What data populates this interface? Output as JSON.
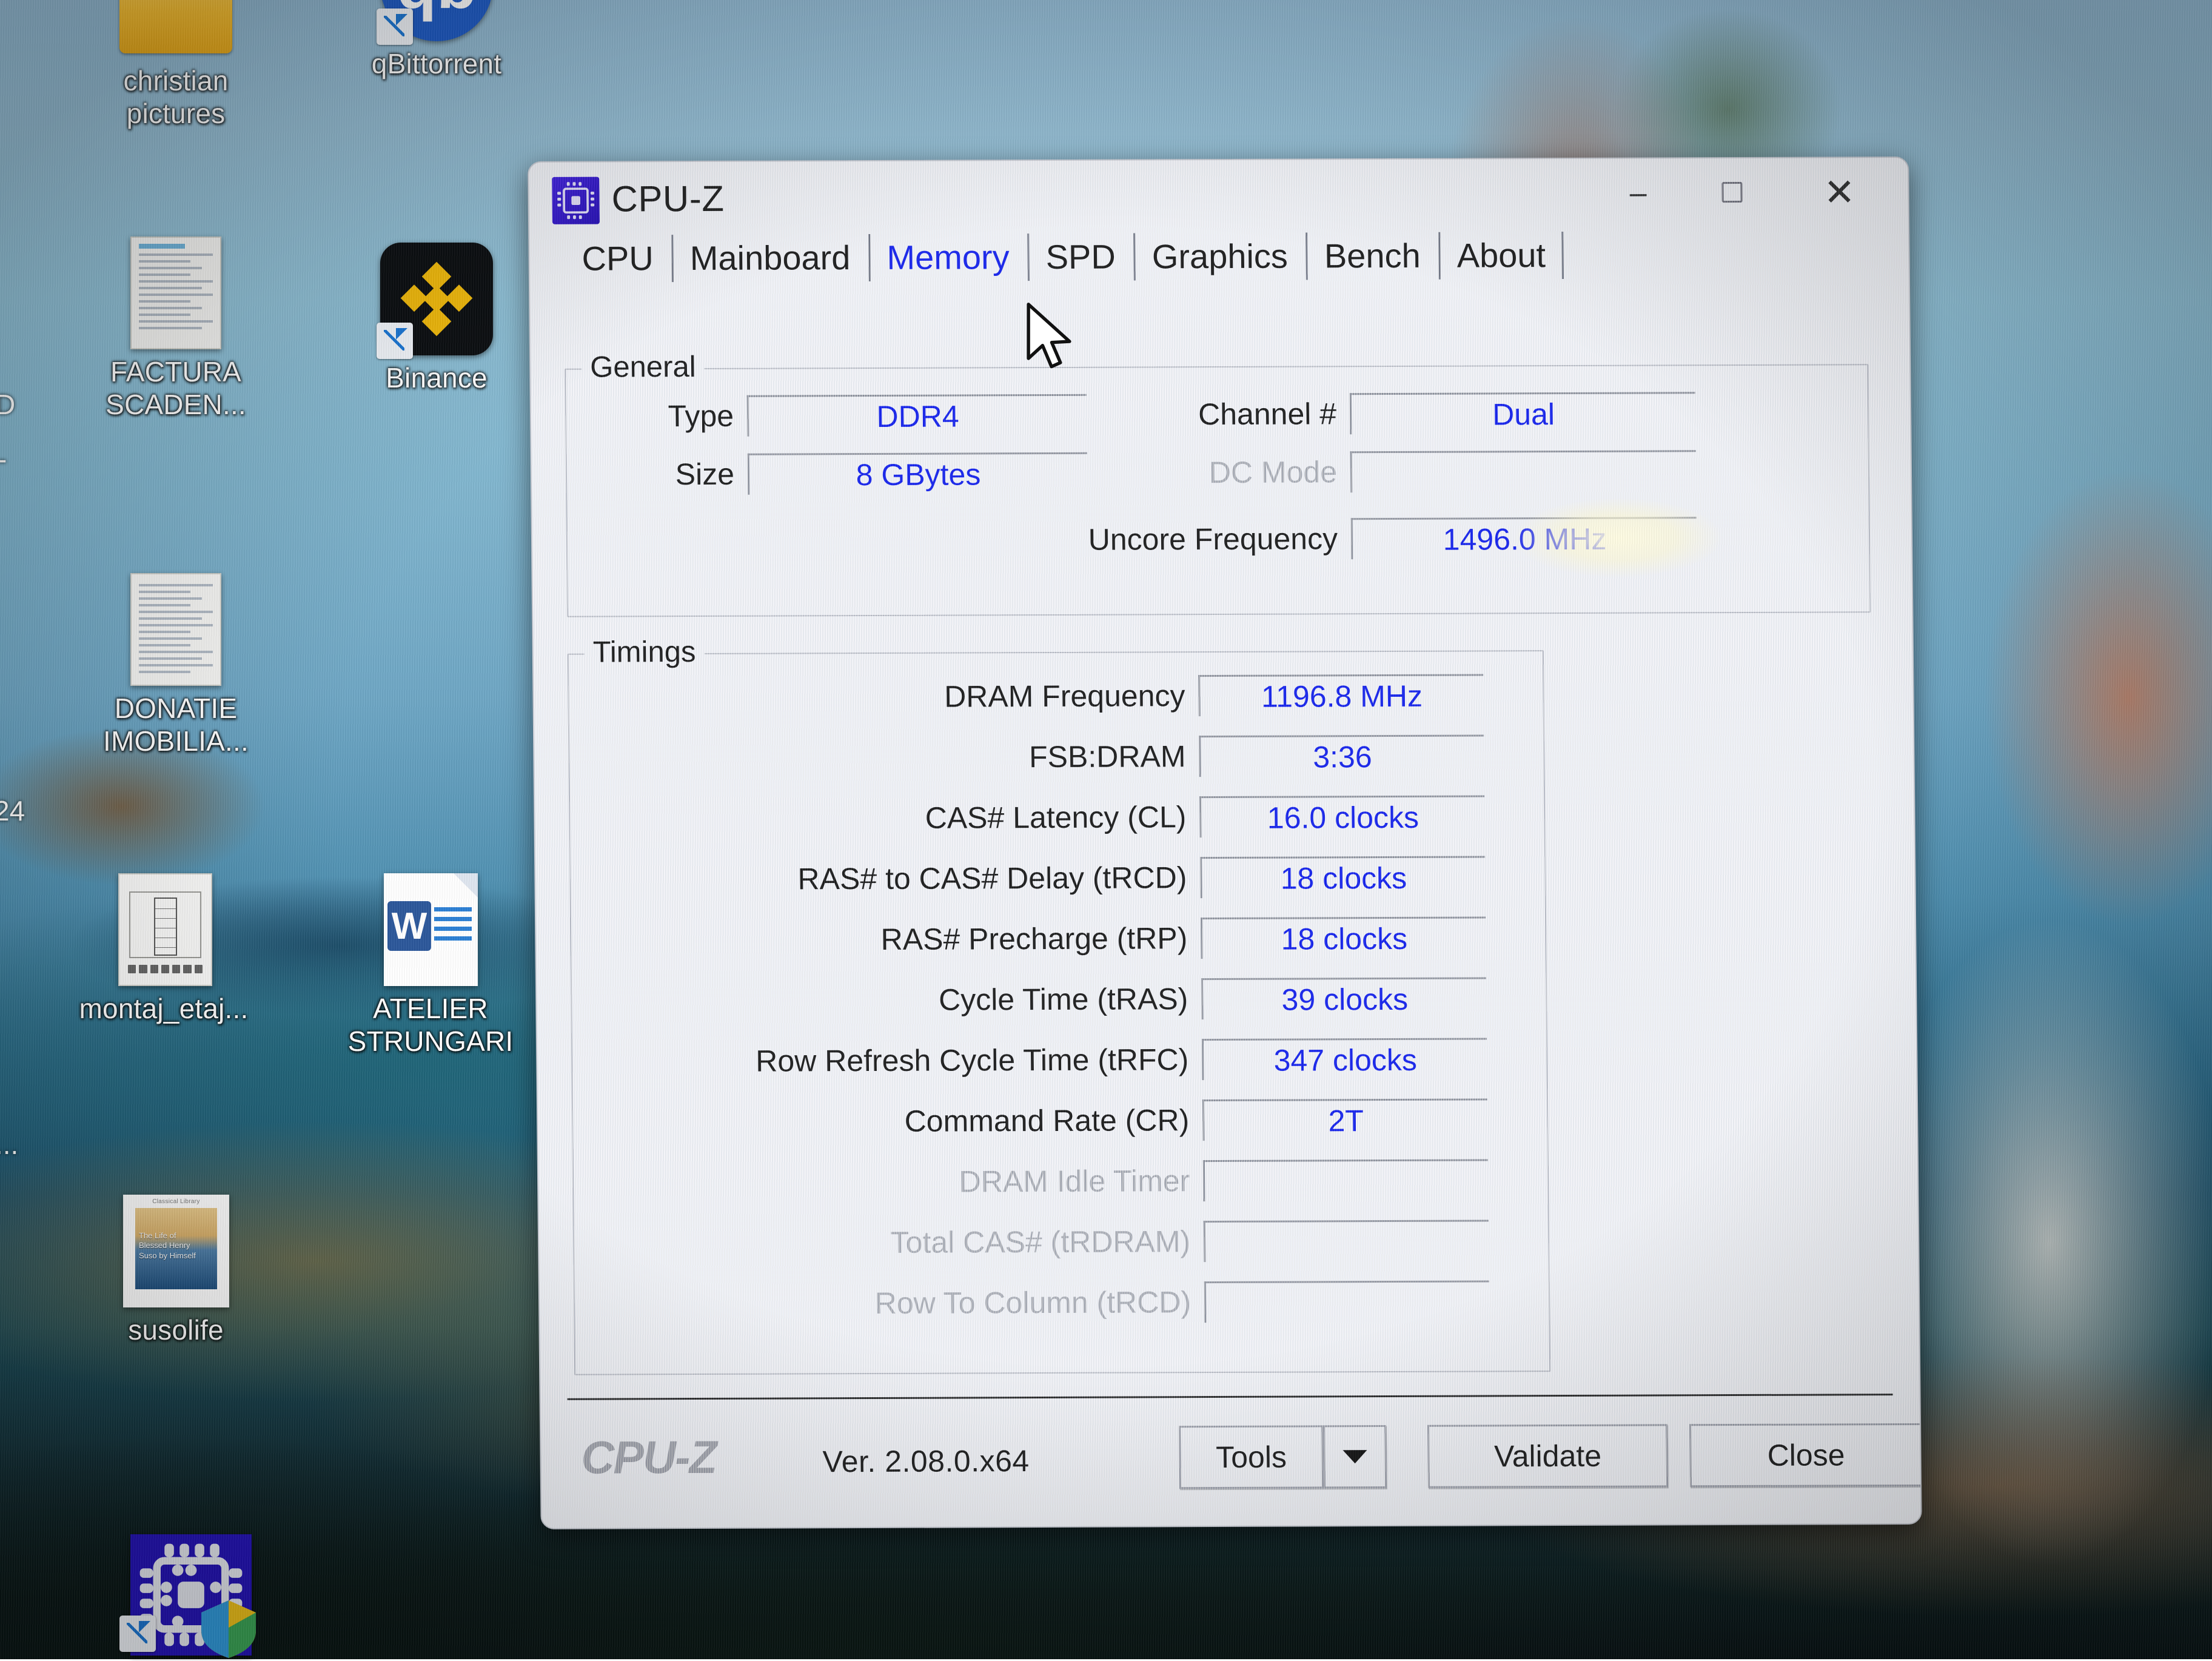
{
  "desktop": {
    "icons": [
      {
        "label": "christian pictures",
        "icon": "folder-icon"
      },
      {
        "label": "qBittorrent",
        "icon": "qbittorrent-icon"
      },
      {
        "label": "FACTURA SCADEN...",
        "icon": "document-icon"
      },
      {
        "label": "Binance",
        "icon": "binance-icon"
      },
      {
        "label": "DONATIE IMOBILIA...",
        "icon": "document-icon"
      },
      {
        "label": "montaj_etaj...",
        "icon": "drawing-document-icon"
      },
      {
        "label": "ATELIER STRUNGARI",
        "icon": "word-document-icon"
      },
      {
        "label": "susolife",
        "icon": "book-cover-icon"
      },
      {
        "label": "",
        "icon": "cpuz-shortcut-icon"
      }
    ],
    "edge_fragments": {
      "left_top_1": "D",
      "left_top_2": "-",
      "left_mid": "24",
      "left_low": "..."
    }
  },
  "window": {
    "title": "CPU-Z",
    "icon": "cpuz-icon",
    "controls": {
      "minimize": "–",
      "maximize": "maximize-icon",
      "close": "✕"
    }
  },
  "tabs": [
    {
      "label": "CPU",
      "selected": false
    },
    {
      "label": "Mainboard",
      "selected": false
    },
    {
      "label": "Memory",
      "selected": true
    },
    {
      "label": "SPD",
      "selected": false
    },
    {
      "label": "Graphics",
      "selected": false
    },
    {
      "label": "Bench",
      "selected": false
    },
    {
      "label": "About",
      "selected": false
    }
  ],
  "general": {
    "title": "General",
    "left": [
      {
        "label": "Type",
        "value": "DDR4",
        "disabled": false
      },
      {
        "label": "Size",
        "value": "8 GBytes",
        "disabled": false
      }
    ],
    "right": [
      {
        "label": "Channel #",
        "value": "Dual",
        "disabled": false
      },
      {
        "label": "DC Mode",
        "value": "",
        "disabled": true
      },
      {
        "label": "Uncore Frequency",
        "value": "1496.0 MHz",
        "disabled": false
      }
    ]
  },
  "timings": {
    "title": "Timings",
    "rows": [
      {
        "label": "DRAM Frequency",
        "value": "1196.8 MHz",
        "disabled": false
      },
      {
        "label": "FSB:DRAM",
        "value": "3:36",
        "disabled": false
      },
      {
        "label": "CAS# Latency (CL)",
        "value": "16.0 clocks",
        "disabled": false
      },
      {
        "label": "RAS# to CAS# Delay (tRCD)",
        "value": "18 clocks",
        "disabled": false
      },
      {
        "label": "RAS# Precharge (tRP)",
        "value": "18 clocks",
        "disabled": false
      },
      {
        "label": "Cycle Time (tRAS)",
        "value": "39 clocks",
        "disabled": false
      },
      {
        "label": "Row Refresh Cycle Time (tRFC)",
        "value": "347 clocks",
        "disabled": false
      },
      {
        "label": "Command Rate (CR)",
        "value": "2T",
        "disabled": false
      },
      {
        "label": "DRAM Idle Timer",
        "value": "",
        "disabled": true
      },
      {
        "label": "Total CAS# (tRDRAM)",
        "value": "",
        "disabled": true
      },
      {
        "label": "Row To Column (tRCD)",
        "value": "",
        "disabled": true
      }
    ]
  },
  "footer": {
    "logo": "CPU-Z",
    "version": "Ver. 2.08.0.x64",
    "tools_label": "Tools",
    "tools_dropdown": "chevron-down-icon",
    "validate_label": "Validate",
    "close_label": "Close"
  },
  "colors": {
    "value_blue": "#1722e8",
    "selected_tab": "#1722e8",
    "disabled_grey": "#a3a6ae",
    "window_bg": "#eef0f6",
    "app_icon_bg": "#2410a8"
  }
}
